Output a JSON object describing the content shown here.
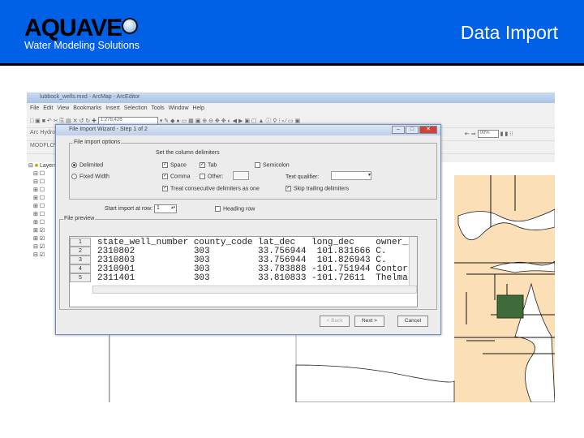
{
  "slide": {
    "logo_main": "AQUAVE",
    "logo_sub": "Water Modeling Solutions",
    "title": "Data Import"
  },
  "arcmap": {
    "title": "lubbock_wells.mxd - ArcMap - ArcEditor",
    "menu": [
      "File",
      "Edit",
      "View",
      "Bookmarks",
      "Insert",
      "Selection",
      "Tools",
      "Window",
      "Help"
    ],
    "scale": "1:278,426",
    "toolbar2": "Arc Hydro",
    "toolbar3": "MODFLOW",
    "toc_root": "Layers",
    "zoom_value": "00%"
  },
  "dialog": {
    "title": "File Import Wizard - Step 1 of 2",
    "options_group": "File import options",
    "delim_heading": "Set the column delimiters",
    "radio_delimited": "Delimited",
    "radio_fixed": "Fixed Width",
    "cb_space": "Space",
    "cb_tab": "Tab",
    "cb_semicolon": "Semicolon",
    "cb_comma": "Comma",
    "cb_other": "Other:",
    "treat_consecutive": "Treat consecutive delimiters as one",
    "text_qualifier": "Text qualifier:",
    "skip_trailing": "Skip trailing delimiters",
    "start_row_label": "Start import at row:",
    "start_row": "1",
    "heading_row": "Heading row",
    "preview_group": "File preview",
    "rows": [
      {
        "n": "1",
        "text": "state_well_number county_code lat_dec   long_dec    owner_"
      },
      {
        "n": "2",
        "text": "2310802           303         33.756944  101.831666 C."
      },
      {
        "n": "3",
        "text": "2310803           303         33.756944  101.826943 C."
      },
      {
        "n": "4",
        "text": "2310901           303         33.783888 -101.751944 Contor"
      },
      {
        "n": "5",
        "text": "2311401           303         33.810833 -101.72611  Thelma"
      }
    ],
    "back": "< Back",
    "next": "Next >",
    "cancel": "Cancel"
  }
}
